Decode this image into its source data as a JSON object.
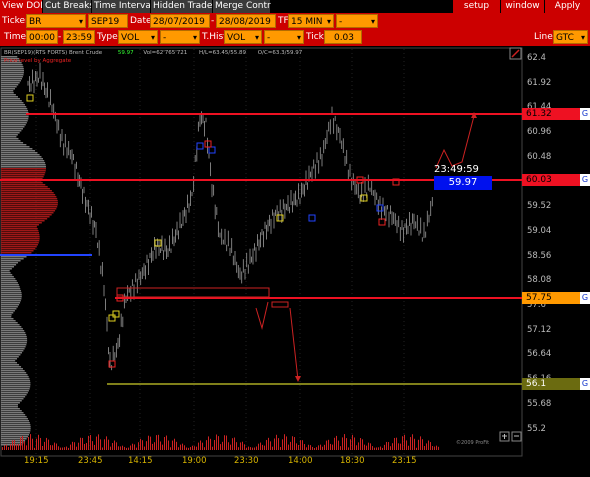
{
  "menu": {
    "tabs": [
      "View DOM",
      "Cut Breaks",
      "Time Interval",
      "Hidden Trades",
      "Merge Contr"
    ],
    "right_buttons": [
      "setup",
      "window",
      "Apply"
    ]
  },
  "toolbar1": {
    "ticker_label": "Ticker",
    "ticker_value": "BR",
    "contract_value": "SEP19",
    "date_label": "Date",
    "date_from": "28/07/2019",
    "date_to": "28/08/2019",
    "tf_label": "TF",
    "tf_value": "15 MIN",
    "tf_extra": "-"
  },
  "toolbar2": {
    "time_label": "Time",
    "time_from": "00:00",
    "time_to": "23:59",
    "type_label": "Type",
    "type_value": "VOL",
    "type_extra": "-",
    "thist_label": "T.Hist",
    "thist_value": "VOL",
    "thist_extra": "-",
    "tick_label": "Tick",
    "tick_value": "0.03",
    "line_label": "Line",
    "line_value": "GTC"
  },
  "chart_info": {
    "symbol": "BR(SEP19)(RTS FORTS) Brent Crude",
    "last": "59.97",
    "vol": "Vol=62'765'721",
    "hl": "H/L=63.45/55.89",
    "oc": "O/C=63.3/59.97",
    "subtitle": "Price level by Aggregate",
    "footer": "©2009 ProFit"
  },
  "price_axis": [
    "62.4",
    "61.92",
    "61.44",
    "60.96",
    "60.48",
    "60.00",
    "59.52",
    "59.04",
    "58.56",
    "58.08",
    "57.6",
    "57.12",
    "56.64",
    "56.16",
    "55.68",
    "55.2"
  ],
  "time_axis": [
    "19:15",
    "23:45",
    "14:15",
    "19:00",
    "23:30",
    "14:00",
    "18:30",
    "23:15"
  ],
  "level_boxes": [
    {
      "value": "61.32",
      "color": "#ee1122",
      "text_color": "#000"
    },
    {
      "value": "60.03",
      "color": "#ee1122",
      "text_color": "#000"
    },
    {
      "value": "57.75",
      "color": "#ff9900",
      "text_color": "#000"
    },
    {
      "value": "56.1",
      "color": "#6b6b10",
      "text_color": "#fff"
    }
  ],
  "g_label": "G",
  "timer": "23:49:59",
  "current_price": "59.97",
  "colors": {
    "accent": "#cc0000",
    "field": "#ff9900",
    "price": "#0011ee",
    "level_line": "#ee1122"
  }
}
